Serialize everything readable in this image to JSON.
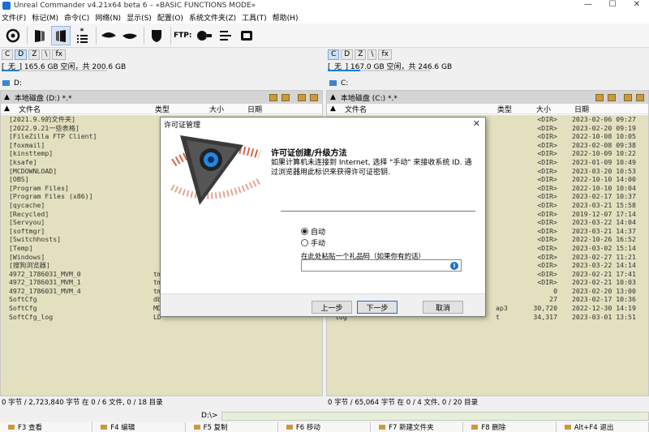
{
  "window": {
    "title": "Unreal Commander v4.21x64 beta 6 – «BASIC FUNCTIONS MODE»",
    "minimize": "—",
    "maximize": "☐",
    "close": "✕"
  },
  "menu": [
    "文件(F)",
    "标记(M)",
    "命令(C)",
    "网络(N)",
    "显示(S)",
    "配置(O)",
    "系统文件夹(Z)",
    "工具(T)",
    "帮助(H)"
  ],
  "toolbar": {
    "ftp_label": "FTP:",
    "icons": [
      "refresh-icon",
      "left-panel-icon",
      "right-panel-icon",
      "select-list-icon",
      "eye-left-icon",
      "eye-right-icon",
      "shield-icon",
      "ftp-connect-icon",
      "ftp-list-icon",
      "ftp-disconnect-icon"
    ]
  },
  "left": {
    "drives": [
      "C",
      "D",
      "Z",
      "\\",
      "fx"
    ],
    "selected_drive": "D",
    "free_info": "[_无_]  165.6 GB 空闲，共 200.6 GB",
    "free_fraction": 0.17,
    "path_label": "D:",
    "header": "本地磁盘 (D:)  *.*",
    "columns": [
      "文件名",
      "类型",
      "大小",
      "日期"
    ],
    "files": [
      {
        "name": "[2021.9.9的文件夹]",
        "type": "",
        "size": "",
        "date": ""
      },
      {
        "name": "[2022.9.21一些表格]",
        "type": "",
        "size": "",
        "date": ""
      },
      {
        "name": "[FileZilla FTP Client]",
        "type": "",
        "size": "",
        "date": ""
      },
      {
        "name": "[foxmail]",
        "type": "",
        "size": "",
        "date": ""
      },
      {
        "name": "[kinsttemp]",
        "type": "",
        "size": "",
        "date": ""
      },
      {
        "name": "[ksafe]",
        "type": "",
        "size": "",
        "date": ""
      },
      {
        "name": "[MCDOWNLOAD]",
        "type": "",
        "size": "",
        "date": ""
      },
      {
        "name": "[OBS]",
        "type": "",
        "size": "",
        "date": ""
      },
      {
        "name": "[Program Files]",
        "type": "",
        "size": "",
        "date": ""
      },
      {
        "name": "[Program Files (x86)]",
        "type": "",
        "size": "",
        "date": ""
      },
      {
        "name": "[qycache]",
        "type": "",
        "size": "",
        "date": ""
      },
      {
        "name": "[Recycled]",
        "type": "",
        "size": "",
        "date": ""
      },
      {
        "name": "[Servyou]",
        "type": "",
        "size": "",
        "date": ""
      },
      {
        "name": "[softmgr]",
        "type": "",
        "size": "",
        "date": ""
      },
      {
        "name": "[Switchhosts]",
        "type": "",
        "size": "",
        "date": ""
      },
      {
        "name": "[Temp]",
        "type": "",
        "size": "",
        "date": ""
      },
      {
        "name": "[Windows]",
        "type": "",
        "size": "",
        "date": ""
      },
      {
        "name": "[搜狗浏览器]",
        "type": "",
        "size": "",
        "date": ""
      },
      {
        "name": "4972_1786031_MVM_0",
        "type": "tm",
        "size": "",
        "date": ""
      },
      {
        "name": "4972_1786031_MVM_1",
        "type": "tm",
        "size": "",
        "date": ""
      },
      {
        "name": "4972_1786031_MVM_4",
        "type": "tm",
        "size": "",
        "date": ""
      },
      {
        "name": "SoftCfg",
        "type": "db",
        "size": "",
        "date": ""
      },
      {
        "name": "SoftCfg",
        "type": "MD",
        "size": "",
        "date": ""
      },
      {
        "name": "SoftCfg_log",
        "type": "LD",
        "size": "",
        "date": ""
      }
    ],
    "status": "0 字节 / 2,723,840 字节 在 0 / 6 文件, 0 / 18 目录"
  },
  "right": {
    "drives": [
      "C",
      "D",
      "Z",
      "\\",
      "fx"
    ],
    "selected_drive": "C",
    "free_info": "[_无_]  167.0 GB 空闲，共 246.6 GB",
    "free_fraction": 0.32,
    "path_label": "C:",
    "header": "本地磁盘 (C:)  *.*",
    "columns": [
      "文件名",
      "类型",
      "大小",
      "日期"
    ],
    "files": [
      {
        "name": "",
        "type": "",
        "size": "<DIR>",
        "date": "2023-02-06 09:27"
      },
      {
        "name": "",
        "type": "",
        "size": "<DIR>",
        "date": "2023-02-20 09:19"
      },
      {
        "name": "",
        "type": "",
        "size": "<DIR>",
        "date": "2022-10-08 10:05"
      },
      {
        "name": "",
        "type": "",
        "size": "<DIR>",
        "date": "2023-02-08 09:38"
      },
      {
        "name": "",
        "type": "",
        "size": "<DIR>",
        "date": "2022-10-09 10:22"
      },
      {
        "name": "",
        "type": "",
        "size": "<DIR>",
        "date": "2023-01-09 10:49"
      },
      {
        "name": "",
        "type": "",
        "size": "<DIR>",
        "date": "2023-03-20 10:53"
      },
      {
        "name": "",
        "type": "",
        "size": "<DIR>",
        "date": "2022-10-10 14:00"
      },
      {
        "name": "",
        "type": "",
        "size": "<DIR>",
        "date": "2022-10-10 10:04"
      },
      {
        "name": "",
        "type": "",
        "size": "<DIR>",
        "date": "2023-02-17 10:37"
      },
      {
        "name": "",
        "type": "",
        "size": "<DIR>",
        "date": "2023-03-21 15:58"
      },
      {
        "name": "",
        "type": "",
        "size": "<DIR>",
        "date": "2019-12-07 17:14"
      },
      {
        "name": "",
        "type": "",
        "size": "<DIR>",
        "date": "2023-03-22 14:04"
      },
      {
        "name": "",
        "type": "",
        "size": "<DIR>",
        "date": "2023-03-21 14:37"
      },
      {
        "name": "",
        "type": "",
        "size": "<DIR>",
        "date": "2022-10-26 16:52"
      },
      {
        "name": "",
        "type": "",
        "size": "<DIR>",
        "date": "2023-03-02 15:14"
      },
      {
        "name": "",
        "type": "",
        "size": "<DIR>",
        "date": "2023-02-27 11:21"
      },
      {
        "name": "",
        "type": "",
        "size": "<DIR>",
        "date": "2023-03-22 14:14"
      },
      {
        "name": "",
        "type": "",
        "size": "<DIR>",
        "date": "2023-02-21 17:41"
      },
      {
        "name": "",
        "type": "",
        "size": "<DIR>",
        "date": "2023-02-21 10:03"
      },
      {
        "name": "",
        "type": "",
        "size": "0",
        "date": "2023-02-20 13:00"
      },
      {
        "name": "",
        "type": "",
        "size": "27",
        "date": "2023-02-17 10:36"
      },
      {
        "name": "",
        "type": "ap3",
        "size": "30,720",
        "date": "2022-12-30 14:19"
      },
      {
        "name": "log",
        "type": "t",
        "size": "34,317",
        "date": "2023-03-01 13:51"
      }
    ],
    "status": "0 字节 / 65,064 字节 在 0 / 4 文件, 0 / 20 目录"
  },
  "cmd": {
    "label": "D:\\>"
  },
  "fkeys": [
    "F3 查看",
    "F4 编辑",
    "F5 复制",
    "F6 移动",
    "F7 新建文件夹",
    "F8 删除",
    "Alt+F4 退出"
  ],
  "dialog": {
    "title": "许可证管理",
    "close": "✕",
    "heading": "许可证创建/升级方法",
    "description": "如果计算机未连接到 Internet, 选择 \"手动\" 来接收系统 ID. 通过浏览器用此标识来获得许可证密钥.",
    "option_auto": "自动",
    "option_manual": "手动",
    "selected_option": "auto",
    "gift_label": "在此处粘贴一个礼品码（如果你有的话）",
    "gift_value": "",
    "info_glyph": "i",
    "btn_prev": "上一步",
    "btn_next": "下一步",
    "btn_cancel": "取消"
  }
}
